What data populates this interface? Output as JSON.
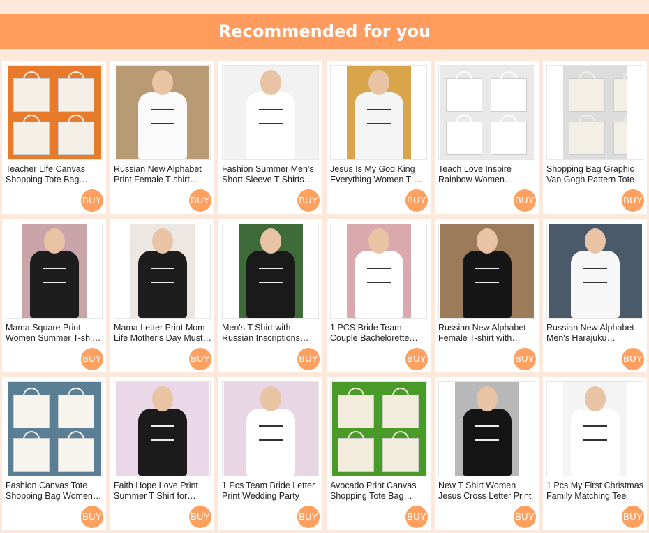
{
  "header": {
    "title": "Recommended for you"
  },
  "buy_label": "BUY",
  "products": [
    {
      "title": "Teacher Life Canvas Shopping Tote Bag Women Harajuku",
      "img_bg": "#e87a2c",
      "art": "bags",
      "art_color": "#f4f0e8"
    },
    {
      "title": "Russian New Alphabet Print Female T-shirt Summer",
      "img_bg": "#b89a74",
      "art": "tee",
      "art_color": "#fafafa"
    },
    {
      "title": "Fashion Summer Men's Short Sleeve T Shirts Doner Kebab",
      "img_bg": "#f2f2f2",
      "art": "tee",
      "art_color": "#ffffff"
    },
    {
      "title": "Jesus Is My God King Everything Women T-shirt",
      "img_bg": "#d9a54a",
      "art": "tee",
      "art_color": "#f5f5f5"
    },
    {
      "title": "Teach Love Inspire Rainbow Women Canvas Bag",
      "img_bg": "#e9e9e9",
      "art": "bags",
      "art_color": "#ffffff"
    },
    {
      "title": "Shopping Bag Graphic Van Gogh Pattern Tote",
      "img_bg": "#dcdcdc",
      "art": "bags",
      "art_color": "#f3efe6"
    },
    {
      "title": "Mama Square Print Women Summer T-shirt Black",
      "img_bg": "#c9a4a8",
      "art": "tee",
      "art_color": "#1d1d1d"
    },
    {
      "title": "Mama Letter Print Mom Life Mother's Day Must Have",
      "img_bg": "#ece7e2",
      "art": "tee",
      "art_color": "#1d1d1d"
    },
    {
      "title": "Men's T Shirt with Russian Inscriptions Beard",
      "img_bg": "#3f6b3a",
      "art": "tee",
      "art_color": "#1a1a1a"
    },
    {
      "title": "1 PCS Bride Team Couple Bachelorette Party Tee",
      "img_bg": "#d9a9ad",
      "art": "tee",
      "art_color": "#ffffff"
    },
    {
      "title": "Russian New Alphabet Female T-shirt with Letters",
      "img_bg": "#9c7b5a",
      "art": "tee",
      "art_color": "#161616"
    },
    {
      "title": "Russian New Alphabet Men's Harajuku Streetwear",
      "img_bg": "#4a5a6a",
      "art": "tee",
      "art_color": "#f7f7f7"
    },
    {
      "title": "Fashion Canvas Tote Shopping Bag Women Eco",
      "img_bg": "#5a7e93",
      "art": "bags",
      "art_color": "#f7f4ee"
    },
    {
      "title": "Faith Hope Love Print Summer T Shirt for Women",
      "img_bg": "#ead8e8",
      "art": "tee",
      "art_color": "#1b1b1b"
    },
    {
      "title": "1 Pcs Team Bride Letter Print Wedding Party",
      "img_bg": "#e8d6e4",
      "art": "tee",
      "art_color": "#ffffff"
    },
    {
      "title": "Avocado Print Canvas Shopping Tote Bag Women",
      "img_bg": "#4a9a2a",
      "art": "bags",
      "art_color": "#f2ecdc"
    },
    {
      "title": "New T Shirt Women Jesus Cross Letter Print",
      "img_bg": "#b8b8b8",
      "art": "tee",
      "art_color": "#151515"
    },
    {
      "title": "1 Pcs My First Christmas Family Matching Tee",
      "img_bg": "#f4f4f4",
      "art": "tee",
      "art_color": "#ffffff"
    }
  ]
}
